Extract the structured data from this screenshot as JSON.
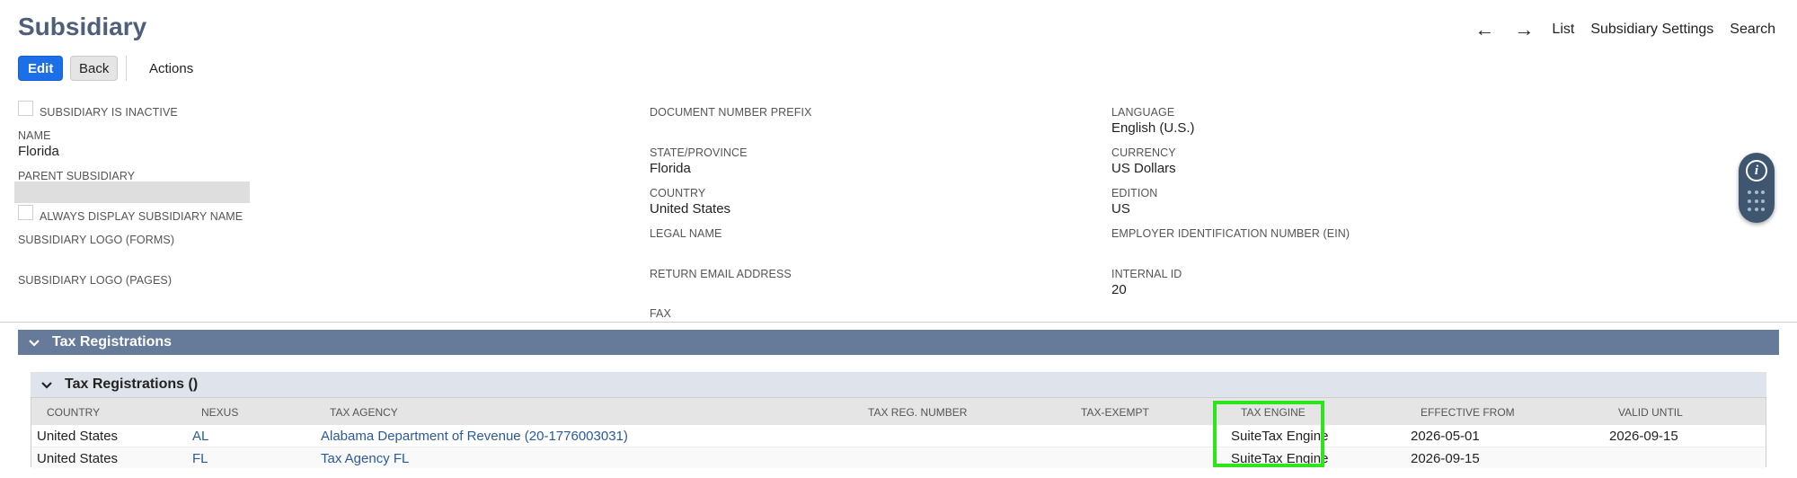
{
  "page": {
    "title": "Subsidiary"
  },
  "nav": {
    "back_arrow": "←",
    "forward_arrow": "→",
    "list": "List",
    "settings": "Subsidiary Settings",
    "search": "Search"
  },
  "toolbar": {
    "edit": "Edit",
    "back": "Back",
    "actions": "Actions"
  },
  "form": {
    "col1": {
      "inactive_label": "SUBSIDIARY IS INACTIVE",
      "name_label": "NAME",
      "name_value": "Florida",
      "parent_label": "PARENT SUBSIDIARY",
      "always_display_label": "ALWAYS DISPLAY SUBSIDIARY NAME",
      "logo_forms_label": "SUBSIDIARY LOGO (FORMS)",
      "logo_pages_label": "SUBSIDIARY LOGO (PAGES)"
    },
    "col2": {
      "doc_prefix_label": "DOCUMENT NUMBER PREFIX",
      "state_label": "STATE/PROVINCE",
      "state_value": "Florida",
      "country_label": "COUNTRY",
      "country_value": "United States",
      "legal_name_label": "LEGAL NAME",
      "return_email_label": "RETURN EMAIL ADDRESS",
      "fax_label": "FAX"
    },
    "col3": {
      "language_label": "LANGUAGE",
      "language_value": "English (U.S.)",
      "currency_label": "CURRENCY",
      "currency_value": "US Dollars",
      "edition_label": "EDITION",
      "edition_value": "US",
      "ein_label": "EMPLOYER IDENTIFICATION NUMBER (EIN)",
      "internal_id_label": "INTERNAL ID",
      "internal_id_value": "20"
    }
  },
  "info_widget": {
    "icon": "info-icon",
    "glyph": "i"
  },
  "section": {
    "title": "Tax Registrations",
    "subtitle": "Tax Registrations ()",
    "chevron": "⌄"
  },
  "table": {
    "columns": [
      "COUNTRY",
      "NEXUS",
      "TAX AGENCY",
      "TAX REG. NUMBER",
      "TAX-EXEMPT",
      "TAX ENGINE",
      "EFFECTIVE FROM",
      "VALID UNTIL"
    ],
    "rows": [
      {
        "country": "United States",
        "nexus": "AL",
        "tax_agency": "Alabama Department of Revenue (20-1776003031)",
        "tax_reg_number": "",
        "tax_exempt": "",
        "tax_engine": "SuiteTax Engine",
        "effective_from": "2026-05-01",
        "valid_until": "2026-09-15"
      },
      {
        "country": "United States",
        "nexus": "FL",
        "tax_agency": "Tax Agency FL",
        "tax_reg_number": "",
        "tax_exempt": "",
        "tax_engine": "SuiteTax Engine",
        "effective_from": "2026-09-15",
        "valid_until": ""
      }
    ]
  },
  "colors": {
    "title": "#4d5f79",
    "primary_button": "#1c6fe8",
    "section_header": "#667a99",
    "sub_header": "#dfe4ec",
    "link": "#2a5a9b",
    "highlight": "#2ee51c"
  }
}
